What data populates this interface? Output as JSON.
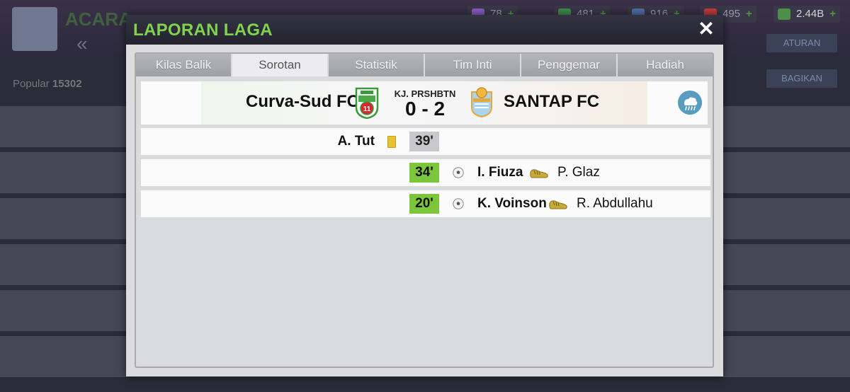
{
  "background": {
    "app_title": "ACARA",
    "resources": [
      "78",
      "481",
      "916",
      "495",
      "2.44B"
    ],
    "side_buttons": [
      "ATURAN",
      "BAGIKAN"
    ],
    "popularity_label": "Popular",
    "popularity_value": "15302"
  },
  "modal": {
    "title": "LAPORAN LAGA",
    "close_symbol": "✕"
  },
  "tabs": [
    "Kilas Balik",
    "Sorotan",
    "Statistik",
    "Tim Inti",
    "Penggemar",
    "Hadiah"
  ],
  "active_tab": "Sorotan",
  "match": {
    "home_team": "Curva-Sud FC",
    "away_team": "SANTAP FC",
    "home_crest_number": "11",
    "score_label": "KJ. PRSHBTN",
    "score": "0 - 2",
    "weather_icon": "rain-cloud-icon"
  },
  "events": [
    {
      "type": "yellow-card",
      "side": "home",
      "player": "A. Tut",
      "minute": "39'"
    },
    {
      "type": "goal",
      "side": "away",
      "player": "I. Fiuza",
      "assist": "P. Glaz",
      "minute": "34'"
    },
    {
      "type": "goal",
      "side": "away",
      "player": "K. Voinson",
      "assist": "R. Abdullahu",
      "minute": "20'"
    }
  ],
  "colors": {
    "title_green": "#7fd34e",
    "goal_minute_green": "#7bc63a",
    "card_minute_gray": "#c9c9cc",
    "yellow_card": "#e6c230"
  }
}
